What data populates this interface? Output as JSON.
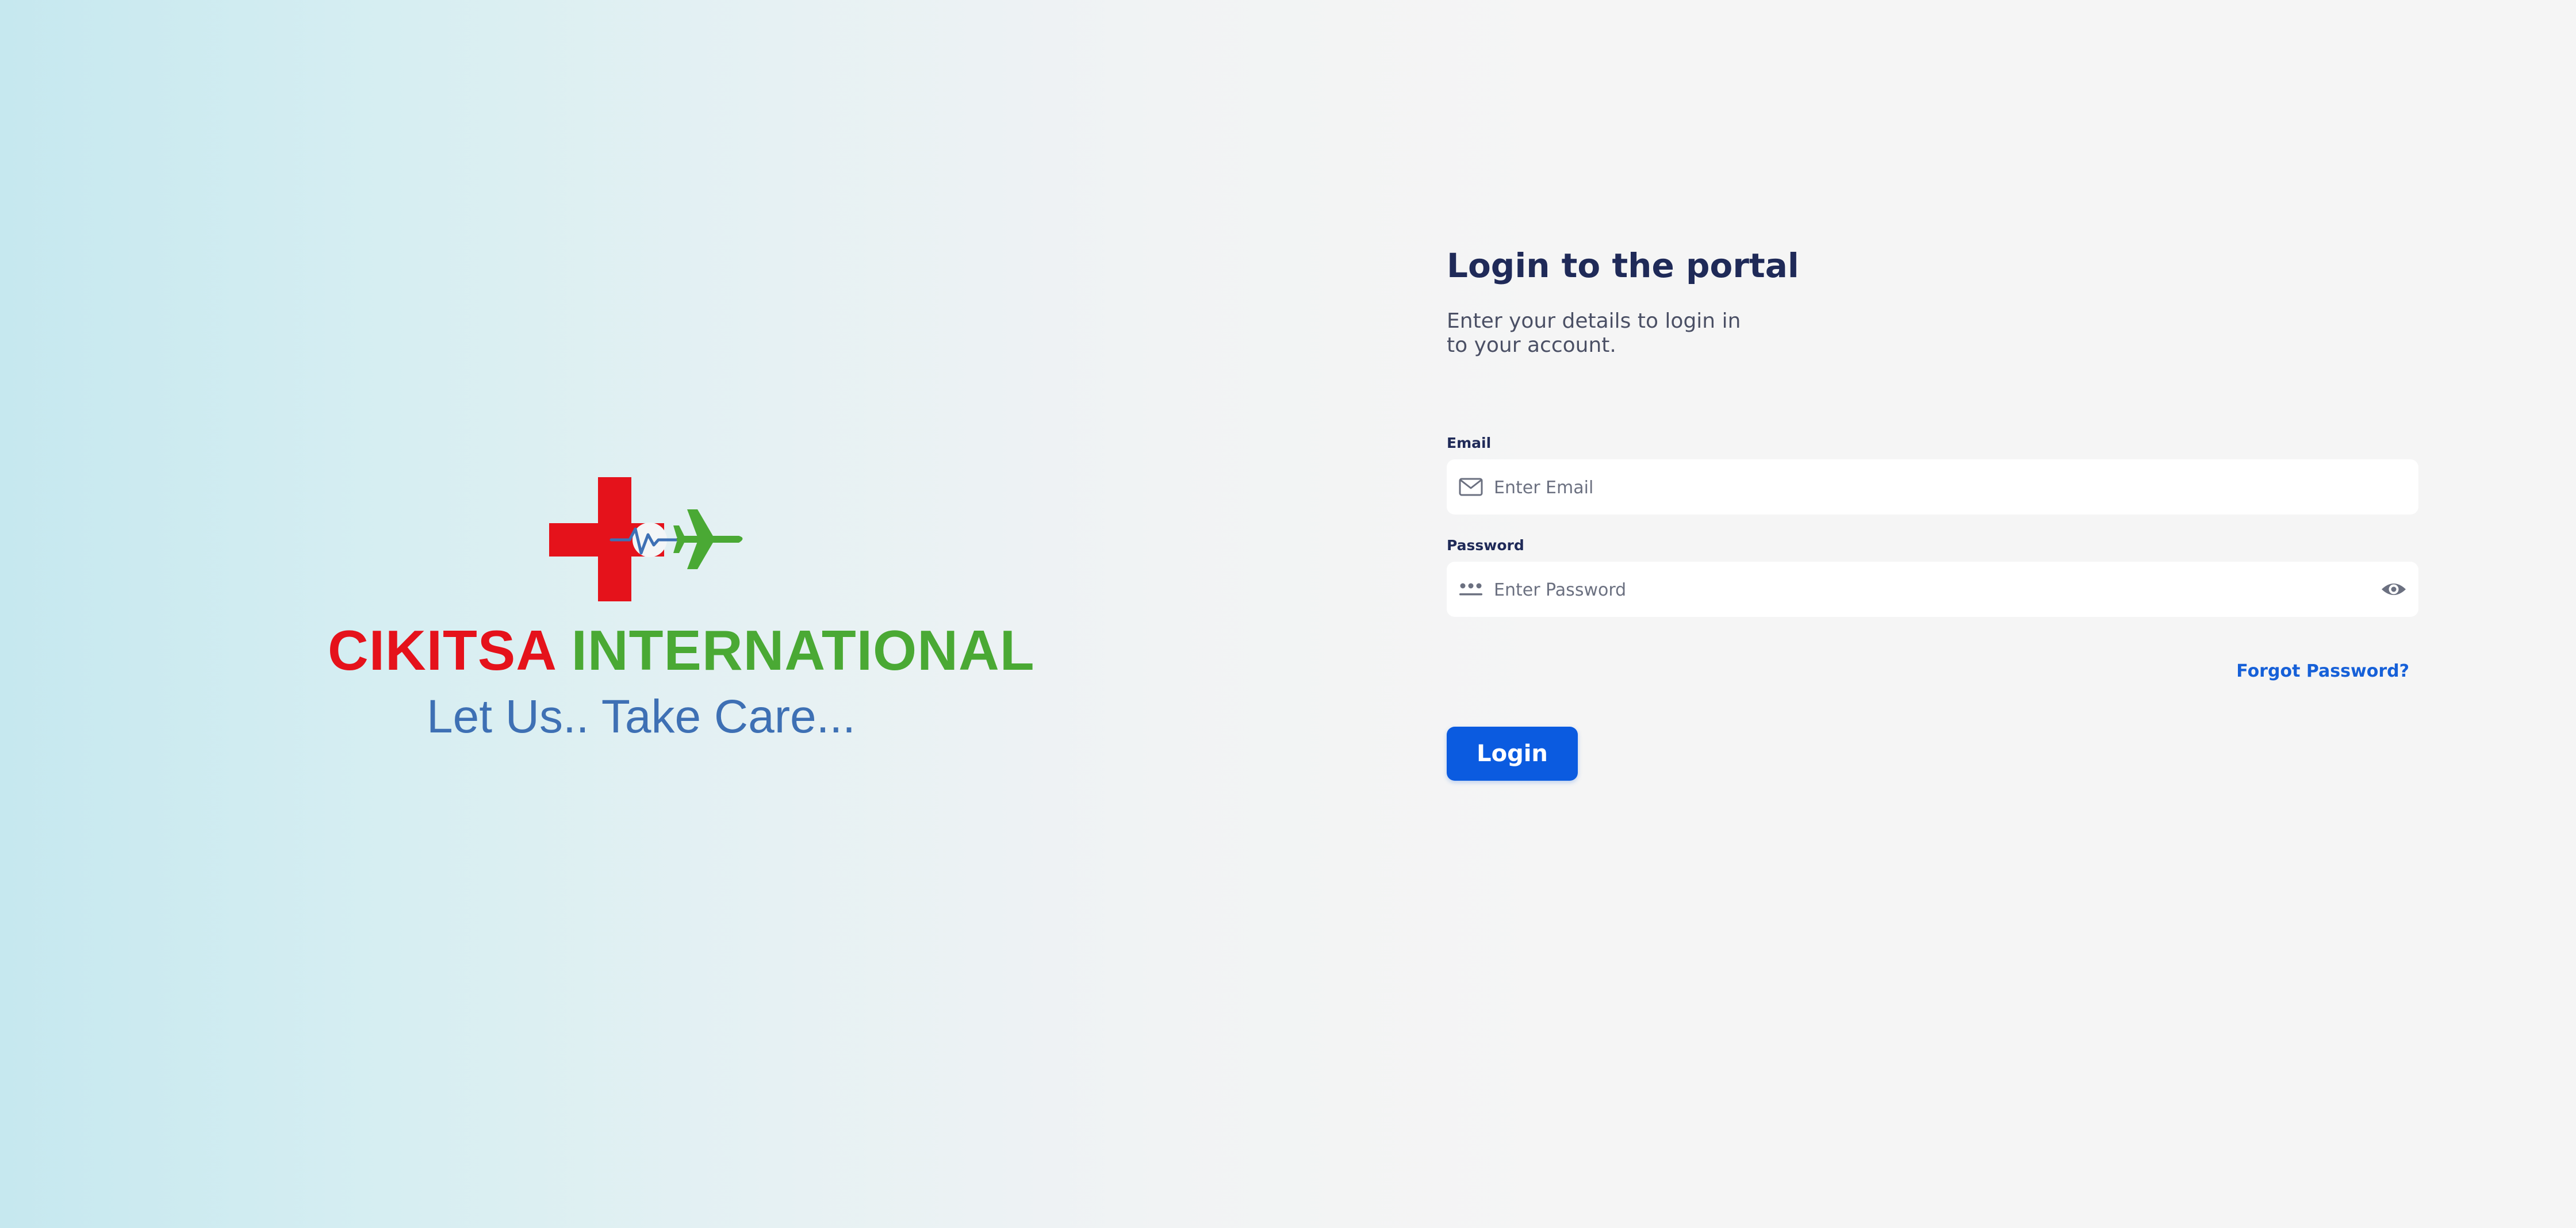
{
  "brand": {
    "name_part1": "CIKITSA",
    "name_part2": "INTERNATIONAL",
    "tagline": "Let Us.. Take Care...",
    "logo_icon": "medical-cross-heartbeat-plane-logo",
    "colors": {
      "red": "#e5121b",
      "green": "#4aa934",
      "blue": "#3e70b4"
    }
  },
  "login": {
    "title": "Login to the portal",
    "subtitle": "Enter your details to login in to your account.",
    "email": {
      "label": "Email",
      "placeholder": "Enter Email",
      "value": "",
      "icon": "mail-icon"
    },
    "password": {
      "label": "Password",
      "placeholder": "Enter Password",
      "value": "",
      "icon": "password-dots-icon",
      "toggle_icon": "eye-icon"
    },
    "forgot_password": "Forgot Password?",
    "submit_label": "Login",
    "colors": {
      "title": "#1f2a58",
      "primary": "#0b5be0",
      "link": "#1660d8"
    }
  }
}
